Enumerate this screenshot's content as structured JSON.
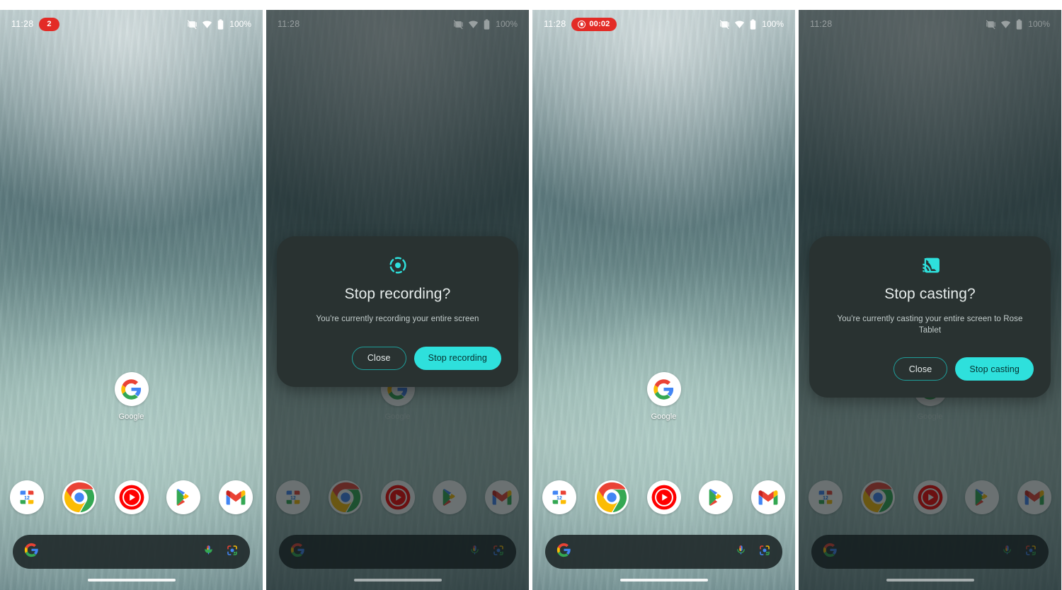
{
  "meta": {
    "panel_count": 4,
    "accent_cyan": "#2ee0dc",
    "accent_outline": "#1f9e9a",
    "dialog_bg": "#293231",
    "chip_red": "#e32b26"
  },
  "status": {
    "time": "11:28",
    "battery_text": "100%",
    "icons": [
      "vibrate-off-icon",
      "wifi-icon",
      "battery-icon"
    ]
  },
  "home": {
    "app_label": "Google",
    "app_icon": "google-g-icon",
    "dock": [
      {
        "name": "dock-icon-calendar",
        "label": "Calendar",
        "day": "12"
      },
      {
        "name": "dock-icon-chrome",
        "label": "Chrome"
      },
      {
        "name": "dock-icon-youtube-music",
        "label": "YouTube Music"
      },
      {
        "name": "dock-icon-play-store",
        "label": "Play Store"
      },
      {
        "name": "dock-icon-gmail",
        "label": "Gmail"
      }
    ],
    "search": {
      "logo_icon": "google-g-icon",
      "mic_icon": "microphone-icon",
      "lens_icon": "google-lens-icon",
      "placeholder": ""
    },
    "nav_indicator": "home-gesture-pill"
  },
  "panels": [
    {
      "id": "panel-1-home-with-badge",
      "dimmed": false,
      "dialog": null,
      "chip": {
        "visible": true,
        "type": "notification-badge",
        "label": "2",
        "show_record_icon": false
      }
    },
    {
      "id": "panel-2-stop-recording-dialog",
      "dimmed": true,
      "chip": {
        "visible": false
      },
      "dialog": {
        "name": "stop-recording-dialog",
        "icon": "screen-record-icon",
        "title": "Stop recording?",
        "subtitle": "You're currently recording your entire screen",
        "close_label": "Close",
        "confirm_label": "Stop recording"
      }
    },
    {
      "id": "panel-3-recording-active",
      "dimmed": false,
      "dialog": null,
      "chip": {
        "visible": true,
        "type": "recording-timer",
        "label": "00:02",
        "show_record_icon": true
      }
    },
    {
      "id": "panel-4-stop-casting-dialog",
      "dimmed": true,
      "chip": {
        "visible": false
      },
      "dialog": {
        "name": "stop-casting-dialog",
        "icon": "cast-icon",
        "title": "Stop casting?",
        "subtitle": "You're currently casting your entire screen to Rose Tablet",
        "close_label": "Close",
        "confirm_label": "Stop casting"
      }
    }
  ]
}
